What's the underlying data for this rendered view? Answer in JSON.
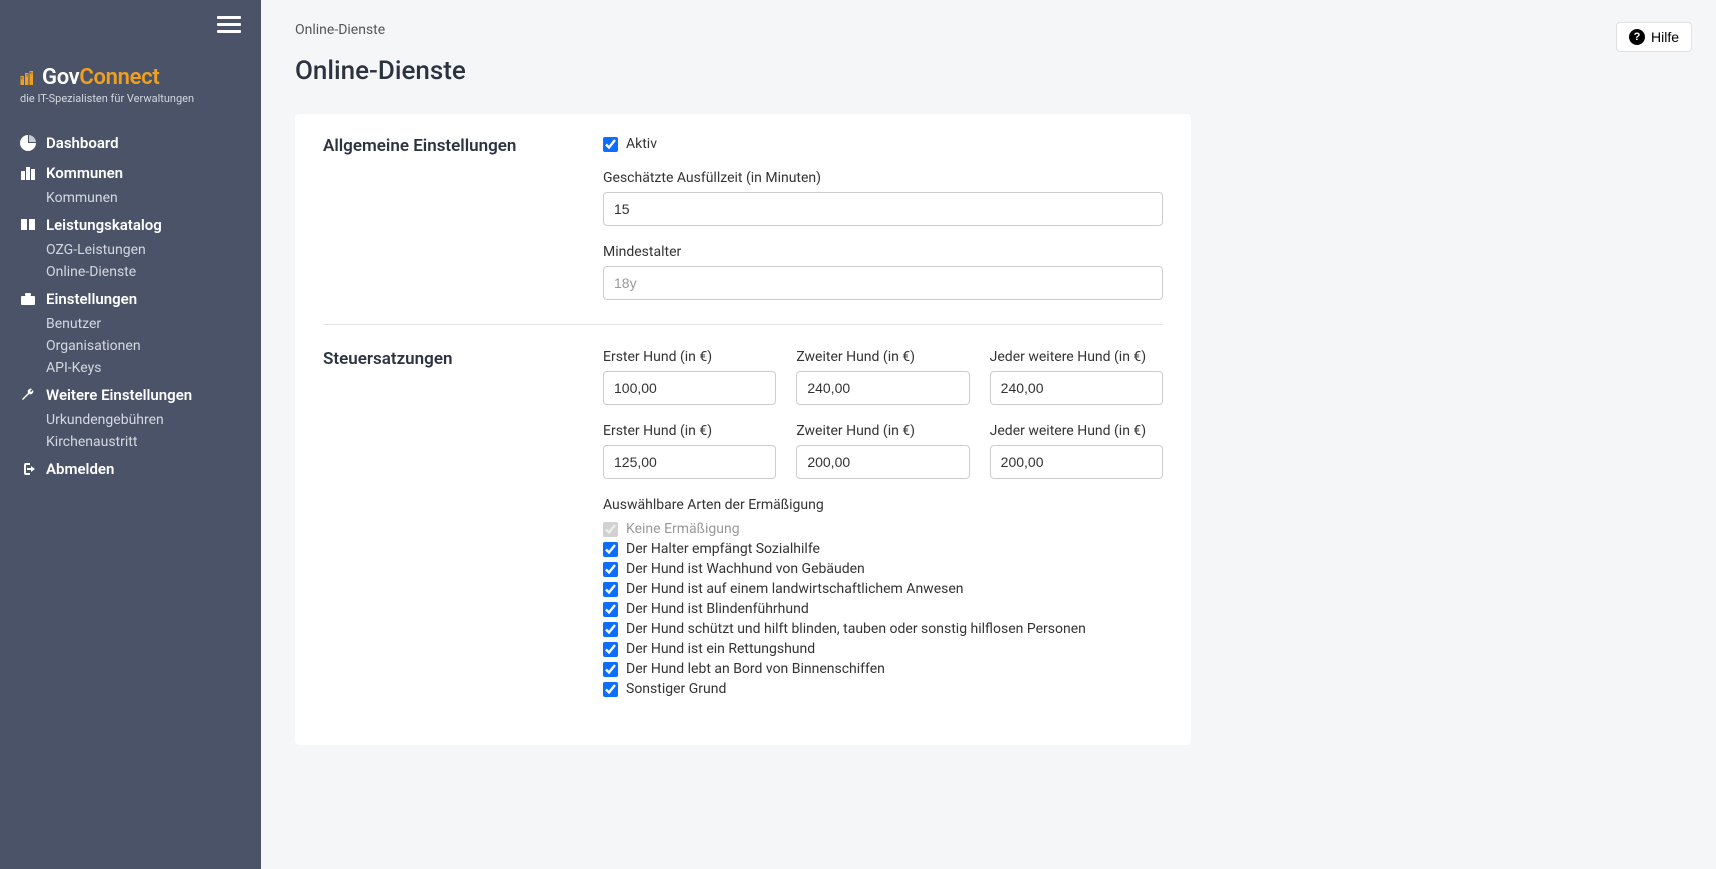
{
  "logo": {
    "brand_prefix": "Gov",
    "brand_suffix": "Connect",
    "tagline": "die IT-Spezialisten für Verwaltungen"
  },
  "nav": {
    "dashboard": "Dashboard",
    "kommunen": {
      "label": "Kommunen",
      "sub": [
        "Kommunen"
      ]
    },
    "leistungskatalog": {
      "label": "Leistungskatalog",
      "sub": [
        "OZG-Leistungen",
        "Online-Dienste"
      ]
    },
    "einstellungen": {
      "label": "Einstellungen",
      "sub": [
        "Benutzer",
        "Organisationen",
        "API-Keys"
      ]
    },
    "weitere": {
      "label": "Weitere Einstellungen",
      "sub": [
        "Urkundengebühren",
        "Kirchenaustritt"
      ]
    },
    "abmelden": "Abmelden"
  },
  "help_label": "Hilfe",
  "breadcrumb": "Online-Dienste",
  "page_title": "Online-Dienste",
  "sections": {
    "general": {
      "title": "Allgemeine Einstellungen",
      "active_label": "Aktiv",
      "est_time_label": "Geschätzte Ausfüllzeit (in Minuten)",
      "est_time_value": "15",
      "min_age_label": "Mindestalter",
      "min_age_placeholder": "18y"
    },
    "tax": {
      "title": "Steuersatzungen",
      "row1": {
        "c1_label": "Erster Hund (in €)",
        "c1_value": "100,00",
        "c2_label": "Zweiter Hund (in €)",
        "c2_value": "240,00",
        "c3_label": "Jeder weitere Hund (in €)",
        "c3_value": "240,00"
      },
      "row2": {
        "c1_label": "Erster Hund (in €)",
        "c1_value": "125,00",
        "c2_label": "Zweiter Hund (in €)",
        "c2_value": "200,00",
        "c3_label": "Jeder weitere Hund (in €)",
        "c3_value": "200,00"
      },
      "discounts_title": "Auswählbare Arten der Ermäßigung",
      "discounts": [
        {
          "label": "Keine Ermäßigung",
          "checked": true,
          "disabled": true
        },
        {
          "label": "Der Halter empfängt Sozialhilfe",
          "checked": true,
          "disabled": false
        },
        {
          "label": "Der Hund ist Wachhund von Gebäuden",
          "checked": true,
          "disabled": false
        },
        {
          "label": "Der Hund ist auf einem landwirtschaftlichem Anwesen",
          "checked": true,
          "disabled": false
        },
        {
          "label": "Der Hund ist Blindenführhund",
          "checked": true,
          "disabled": false
        },
        {
          "label": "Der Hund schützt und hilft blinden, tauben oder sonstig hilflosen Personen",
          "checked": true,
          "disabled": false
        },
        {
          "label": "Der Hund ist ein Rettungshund",
          "checked": true,
          "disabled": false
        },
        {
          "label": "Der Hund lebt an Bord von Binnenschiffen",
          "checked": true,
          "disabled": false
        },
        {
          "label": "Sonstiger Grund",
          "checked": true,
          "disabled": false
        }
      ]
    }
  }
}
